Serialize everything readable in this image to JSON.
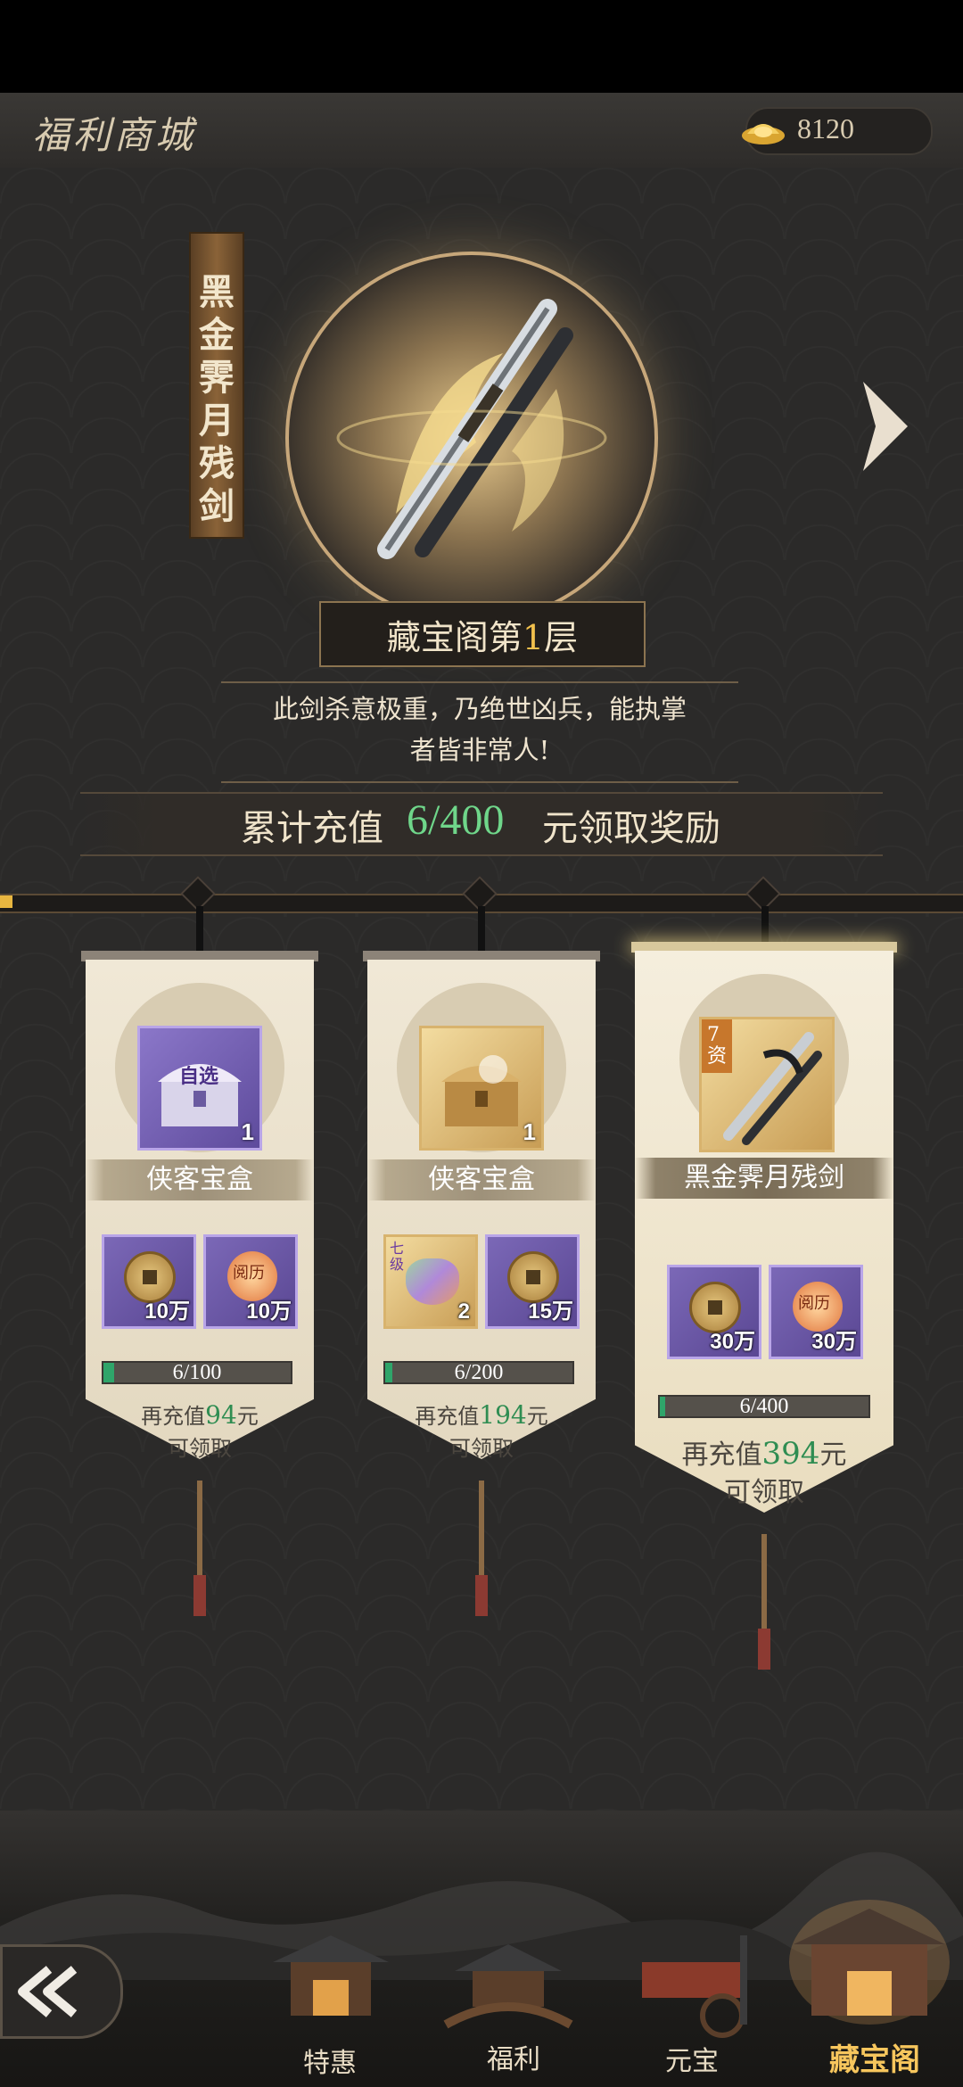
{
  "header": {
    "title": "福利商城",
    "currency_amount": "8120"
  },
  "featured": {
    "name": "黑金霁月残剑",
    "floor_prefix": "藏宝阁第",
    "floor_number": "1",
    "floor_suffix": "层",
    "description_line1": "此剑杀意极重，乃绝世凶兵，能执掌",
    "description_line2": "者皆非常人!"
  },
  "recharge": {
    "prefix": "累计充值",
    "progress": "6/400",
    "suffix": "元领取奖励",
    "fraction": 0.015
  },
  "tiers": [
    {
      "item_name": "侠客宝盒",
      "item_count": "1",
      "item_tag": "自选",
      "rewards": [
        {
          "icon": "copper-coin-icon",
          "amount": "10万"
        },
        {
          "icon": "experience-orb-icon",
          "tag": "阅历",
          "amount": "10万"
        }
      ],
      "progress_text": "6/100",
      "progress_fraction": 0.06,
      "more_prefix": "再充值",
      "more_amount": "94",
      "more_unit": "元",
      "claim_text": "可领取"
    },
    {
      "item_name": "侠客宝盒",
      "item_count": "1",
      "rewards": [
        {
          "icon": "seven-level-bag-icon",
          "tag": "七级",
          "amount": "2"
        },
        {
          "icon": "copper-coin-icon",
          "amount": "15万"
        }
      ],
      "progress_text": "6/200",
      "progress_fraction": 0.03,
      "more_prefix": "再充值",
      "more_amount": "194",
      "more_unit": "元",
      "claim_text": "可领取"
    },
    {
      "item_name": "黑金霁月残剑",
      "item_tag": "7资",
      "rewards": [
        {
          "icon": "copper-coin-icon",
          "amount": "30万"
        },
        {
          "icon": "experience-orb-icon",
          "tag": "阅历",
          "amount": "30万"
        }
      ],
      "progress_text": "6/400",
      "progress_fraction": 0.015,
      "more_prefix": "再充值",
      "more_amount": "394",
      "more_unit": "元",
      "claim_text": "可领取"
    }
  ],
  "bottom_nav": [
    {
      "label": "特惠"
    },
    {
      "label": "福利"
    },
    {
      "label": "元宝"
    },
    {
      "label": "藏宝阁",
      "active": true
    }
  ]
}
